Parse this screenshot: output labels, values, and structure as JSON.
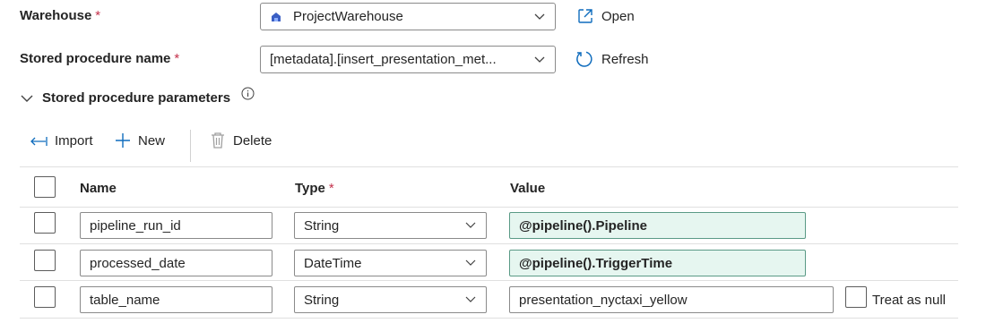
{
  "form": {
    "warehouse": {
      "label": "Warehouse",
      "required_mark": "*",
      "selected": "ProjectWarehouse",
      "action_label": "Open",
      "action_icon": "open-external-icon"
    },
    "stored_procedure": {
      "label": "Stored procedure name",
      "required_mark": "*",
      "selected": "[metadata].[insert_presentation_met...",
      "action_label": "Refresh",
      "action_icon": "refresh-icon"
    }
  },
  "parameters": {
    "section_title": "Stored procedure parameters",
    "info_icon": "info-icon",
    "toolbar": {
      "import_label": "Import",
      "new_label": "New",
      "delete_label": "Delete"
    },
    "columns": {
      "name": "Name",
      "type": "Type",
      "type_required": "*",
      "value": "Value"
    },
    "rows": [
      {
        "name": "pipeline_run_id",
        "type": "String",
        "value": "@pipeline().Pipeline"
      },
      {
        "name": "processed_date",
        "type": "DateTime",
        "value": "@pipeline().TriggerTime"
      },
      {
        "name": "table_name",
        "type": "String",
        "value": "presentation_nyctaxi_yellow",
        "null_option": "Treat as null"
      }
    ]
  },
  "colors": {
    "accent": "#0f6cbd",
    "required": "#c4314b",
    "expression_bg": "#e6f6f0",
    "expression_border": "#5a9a86"
  }
}
